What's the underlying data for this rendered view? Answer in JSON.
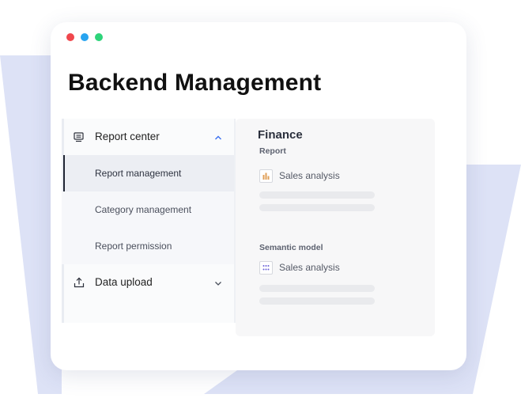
{
  "app": {
    "title": "Backend Management"
  },
  "window_controls": [
    {
      "name": "close",
      "color": "#f0474d"
    },
    {
      "name": "minimize",
      "color": "#28a4f0"
    },
    {
      "name": "maximize",
      "color": "#2ed47a"
    }
  ],
  "sidebar": {
    "groups": [
      {
        "label": "Report center",
        "icon": "report-icon",
        "expanded": true,
        "items": [
          {
            "label": "Report management",
            "active": true
          },
          {
            "label": "Category management",
            "active": false
          },
          {
            "label": "Report permission",
            "active": false
          }
        ]
      },
      {
        "label": "Data upload",
        "icon": "upload-icon",
        "expanded": false,
        "items": []
      }
    ]
  },
  "panel": {
    "title": "Finance",
    "sections": [
      {
        "label": "Report",
        "item": {
          "label": "Sales analysis",
          "icon": "bar-chart-icon"
        }
      },
      {
        "label": "Semantic model",
        "item": {
          "label": "Sales analysis",
          "icon": "grid-dots-icon"
        }
      }
    ]
  },
  "colors": {
    "accent": "#3a6ff0",
    "background_shape": "#dde2f6"
  }
}
